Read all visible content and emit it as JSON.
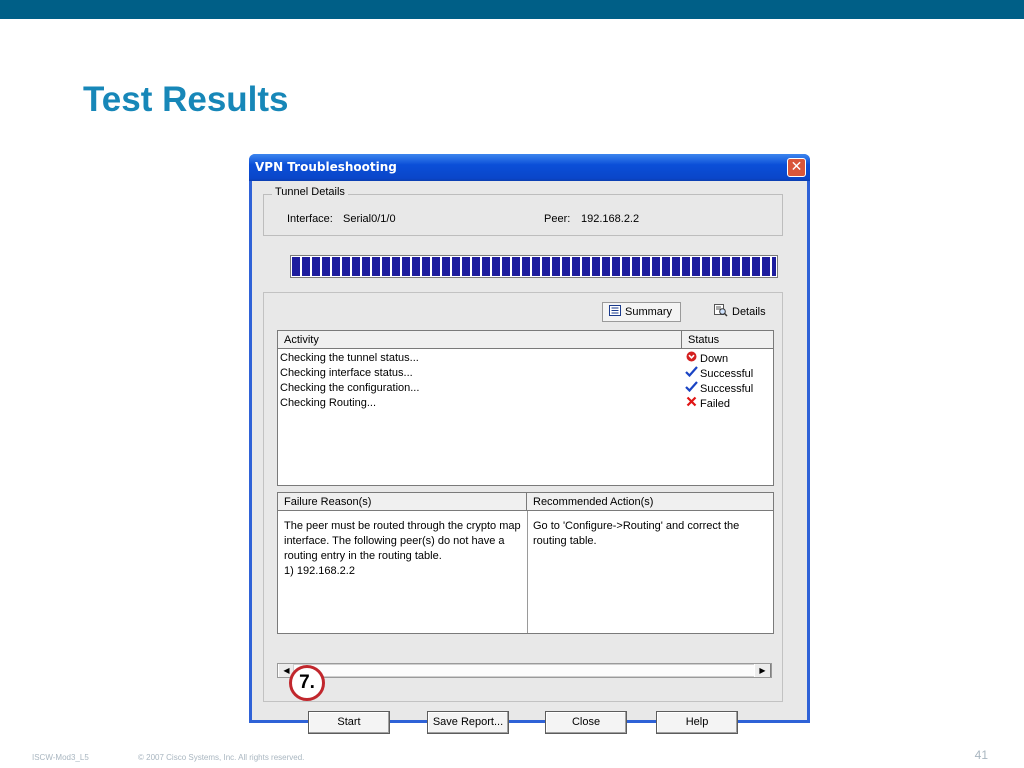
{
  "slide": {
    "title": "Test Results",
    "footer_left": "ISCW-Mod3_L5",
    "footer_copyright": "© 2007 Cisco Systems, Inc. All rights reserved.",
    "page_number": "41",
    "step_badge": "7."
  },
  "window": {
    "title": "VPN Troubleshooting",
    "close_glyph": "✕",
    "tunnel_details": {
      "legend": "Tunnel Details",
      "interface_label": "Interface:",
      "interface_value": "Serial0/1/0",
      "peer_label": "Peer:",
      "peer_value": "192.168.2.2"
    },
    "progress": {
      "value": 1.0,
      "color": "#1d1d9e"
    },
    "view_tabs": {
      "summary": "Summary",
      "details": "Details"
    },
    "activity_table": {
      "headers": {
        "activity": "Activity",
        "status": "Status"
      },
      "rows": [
        {
          "activity": "Checking the tunnel status...",
          "status": "Down",
          "icon": "down-icon",
          "icon_color": "#d42020"
        },
        {
          "activity": "Checking interface status...",
          "status": "Successful",
          "icon": "check-icon",
          "icon_color": "#1a44c4"
        },
        {
          "activity": "Checking the configuration...",
          "status": "Successful",
          "icon": "check-icon",
          "icon_color": "#1a44c4"
        },
        {
          "activity": "Checking Routing...",
          "status": "Failed",
          "icon": "cross-icon",
          "icon_color": "#e01515"
        }
      ]
    },
    "failure_panel": {
      "failure_header": "Failure Reason(s)",
      "action_header": "Recommended Action(s)",
      "failure_lines": [
        "The peer must be routed through the crypto map",
        "interface. The following peer(s) do not have a",
        "routing entry in the routing table.",
        "1) 192.168.2.2"
      ],
      "action_lines": [
        "Go to 'Configure->Routing' and correct the",
        "routing table."
      ]
    },
    "buttons": {
      "start": "Start",
      "save_report": "Save Report...",
      "close": "Close",
      "help": "Help"
    }
  }
}
